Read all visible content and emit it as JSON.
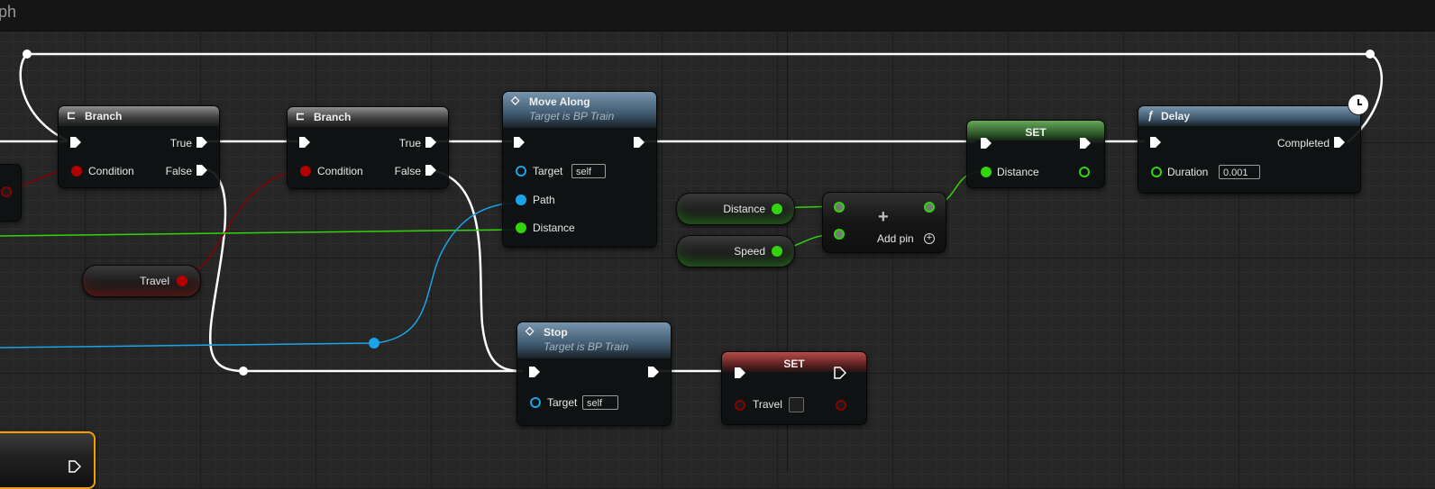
{
  "graph": {
    "tab_title": "ph"
  },
  "nodes": {
    "branch1": {
      "title": "Branch",
      "condition_label": "Condition",
      "true_label": "True",
      "false_label": "False"
    },
    "branch2": {
      "title": "Branch",
      "condition_label": "Condition",
      "true_label": "True",
      "false_label": "False"
    },
    "travel_getter": {
      "label": "Travel"
    },
    "move_along": {
      "title": "Move Along",
      "subtitle": "Target is BP Train",
      "target_label": "Target",
      "target_value": "self",
      "path_label": "Path",
      "distance_label": "Distance"
    },
    "stop": {
      "title": "Stop",
      "subtitle": "Target is BP Train",
      "target_label": "Target",
      "target_value": "self"
    },
    "distance_getter": {
      "label": "Distance"
    },
    "speed_getter": {
      "label": "Speed"
    },
    "add": {
      "add_pin_label": "Add pin",
      "symbol": "+"
    },
    "set_distance": {
      "title": "SET",
      "pin_label": "Distance"
    },
    "set_travel": {
      "title": "SET",
      "pin_label": "Travel"
    },
    "delay": {
      "title": "Delay",
      "func_symbol": "ƒ",
      "completed_label": "Completed",
      "duration_label": "Duration",
      "duration_value": "0.001"
    }
  },
  "colors": {
    "exec": "#ffffff",
    "float": "#32d40c",
    "bool": "#b30000",
    "object": "#1ba3e8"
  }
}
